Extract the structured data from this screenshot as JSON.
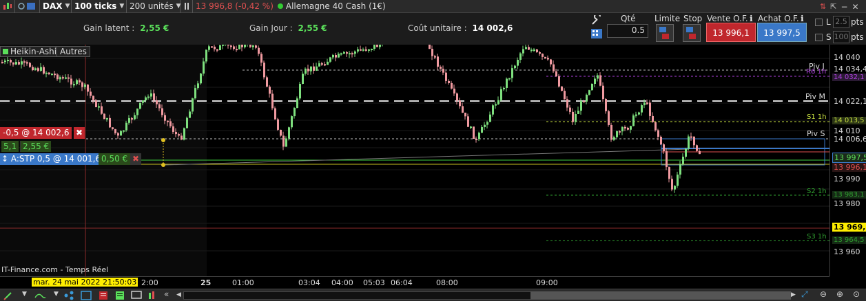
{
  "toolbar": {
    "instrument": "DAX",
    "period": "100 ticks",
    "units": "200 unités",
    "price_change": "13 996,8 (-0,42 %)",
    "market_name": "Allemagne 40 Cash (1€)"
  },
  "info": {
    "gain_latent_label": "Gain latent :",
    "gain_latent_value": "2,55 €",
    "gain_jour_label": "Gain Jour :",
    "gain_jour_value": "2,55 €",
    "cout_label": "Coût unitaire :",
    "cout_value": "14 002,6"
  },
  "order": {
    "qty_label": "Qté",
    "qty_value": "0.5",
    "limit_label": "Limite",
    "stop_label": "Stop",
    "sell_label": "Vente O.F.",
    "sell_price": "13 996,1",
    "buy_label": "Achat O.F.",
    "buy_price": "13 997,5",
    "l_label": "L",
    "s_label": "S",
    "l_value": "2.5",
    "s_value": "100",
    "pts_label": "pts"
  },
  "chart": {
    "style_label": "Heikin-Ashi",
    "other_label": "Autres",
    "position_label": "-0,5 @ 14 002,6",
    "pos_small": "5,1",
    "pos_gain": "2,55 €",
    "stop_order_label": "A:STP 0,5 @ 14 001,6",
    "stop_gain": "0,50 €",
    "source_label": "IT-Finance.com - Temps Réel",
    "pivots": [
      {
        "label": "Piv J",
        "color": "#dddddd"
      },
      {
        "label": "R6 1h",
        "color": "#b040e0"
      },
      {
        "label": "Piv M",
        "color": "#dddddd"
      },
      {
        "label": "S1 1h",
        "color": "#c8e040"
      },
      {
        "label": "Piv S",
        "color": "#dddddd"
      },
      {
        "label": "S2 1h",
        "color": "#30a030"
      },
      {
        "label": "S3 1h",
        "color": "#30a030"
      }
    ],
    "y_labels": [
      "14 040",
      "14 034,4",
      "14 032,1",
      "14 022,1",
      "14 013,5",
      "14 010",
      "14 006,6",
      "13 997,5",
      "13 996,1",
      "13 990",
      "13 983,1",
      "13 980",
      "13 969,8",
      "13 964,5",
      "13 960"
    ],
    "x_labels": [
      "2:00",
      "25",
      "01:00",
      "03:04",
      "04:00",
      "05:03",
      "06:04",
      "08:00",
      "09:00"
    ],
    "cursor_date": "mar. 24 mai 2022 21:50:03"
  }
}
